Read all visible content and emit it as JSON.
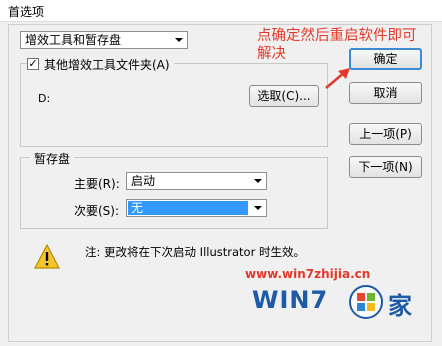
{
  "window": {
    "title": "首选项"
  },
  "category": {
    "selected": "增效工具和暂存盘"
  },
  "plugins": {
    "checkbox_label": "其他增效工具文件夹(A)",
    "checked_mark": "✓",
    "path": "D:",
    "choose_button": "选取(C)..."
  },
  "scratch": {
    "legend": "暂存盘",
    "primary_label": "主要(R):",
    "primary_value": "启动",
    "secondary_label": "次要(S):",
    "secondary_value": "无"
  },
  "note": "注: 更改将在下次启动 Illustrator 时生效。",
  "buttons": {
    "ok": "确定",
    "cancel": "取消",
    "prev": "上一项(P)",
    "next": "下一项(N)"
  },
  "annotation": {
    "line1": "点确定然后重启软件即可",
    "line2": "解决"
  },
  "watermark": {
    "url": "www.win7zhijia.cn",
    "logo": "WIN7",
    "cn": "家"
  },
  "colors": {
    "annotation": "#e23a2a",
    "selection": "#3399ff",
    "default_button_border": "#3a8ad6"
  },
  "icons": {
    "warning": "warning-icon",
    "arrow": "red-arrow-icon"
  }
}
